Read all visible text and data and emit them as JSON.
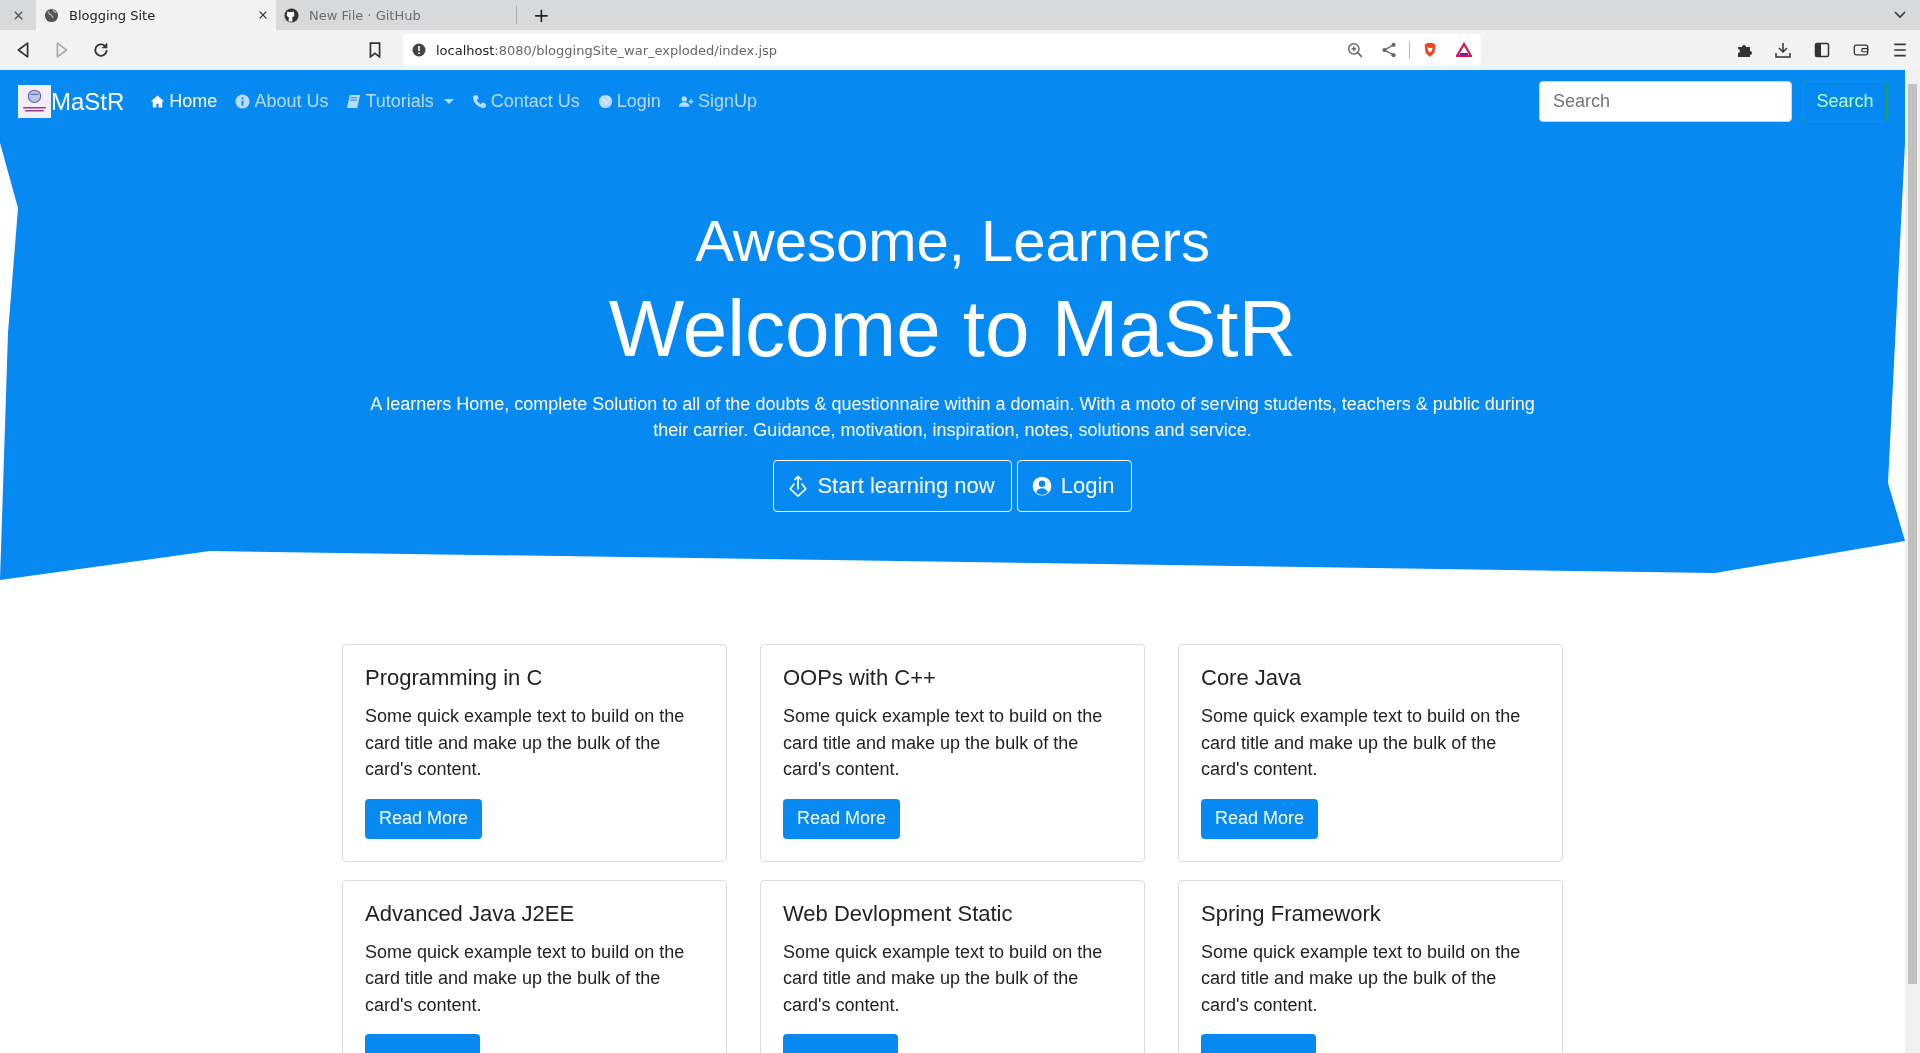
{
  "browser": {
    "tabs": [
      {
        "title": "Blogging Site",
        "selected": true
      },
      {
        "title": "New File · GitHub",
        "selected": false
      }
    ],
    "new_tab": "+",
    "address": {
      "host": "localhost",
      "path": ":8080/bloggingSite_war_exploded/index.jsp"
    }
  },
  "navbar": {
    "brand": "MaStR",
    "links": [
      {
        "label": "Home",
        "selected": true,
        "dropdown": false
      },
      {
        "label": "About Us",
        "selected": false,
        "dropdown": false
      },
      {
        "label": "Tutorials",
        "selected": false,
        "dropdown": true
      },
      {
        "label": "Contact Us",
        "selected": false,
        "dropdown": false
      },
      {
        "label": "Login",
        "selected": false,
        "dropdown": false
      },
      {
        "label": "SignUp",
        "selected": false,
        "dropdown": false
      }
    ],
    "search": {
      "placeholder": "Search",
      "button": "Search"
    }
  },
  "hero": {
    "title": "Awesome, Learners",
    "heading": "Welcome to MaStR",
    "text": "A learners Home, complete Solution to all of the doubts & questionnaire within a domain. With a moto of serving students, teachers & public during their carrier. Guidance, motivation, inspiration, notes, solutions and service.",
    "buttons": [
      {
        "label": "Start learning now"
      },
      {
        "label": "Login"
      }
    ]
  },
  "cards": [
    {
      "title": "Programming in C",
      "text": "Some quick example text to build on the card title and make up the bulk of the card's content.",
      "button": "Read More"
    },
    {
      "title": "OOPs with C++",
      "text": "Some quick example text to build on the card title and make up the bulk of the card's content.",
      "button": "Read More"
    },
    {
      "title": "Core Java",
      "text": "Some quick example text to build on the card title and make up the bulk of the card's content.",
      "button": "Read More"
    },
    {
      "title": "Advanced Java J2EE",
      "text": "Some quick example text to build on the card title and make up the bulk of the card's content."
    },
    {
      "title": "Web Devlopment Static",
      "text": "Some quick example text to build on the card title and make up the bulk of the card's content."
    },
    {
      "title": "Spring Framework",
      "text": "Some quick example text to build on the card title and make up the bulk of the card's content."
    }
  ]
}
